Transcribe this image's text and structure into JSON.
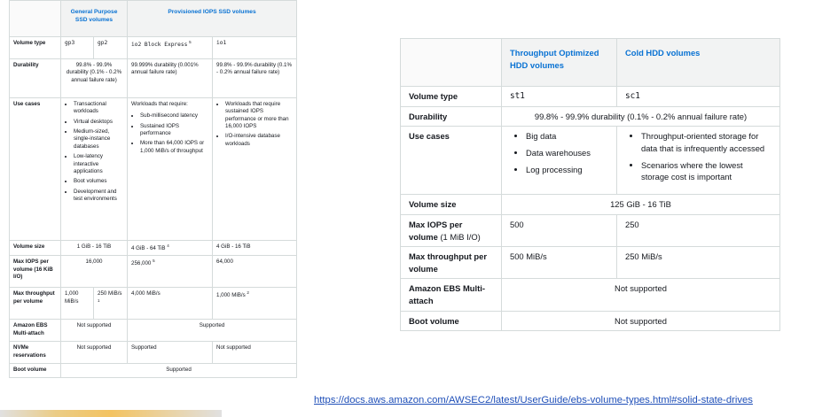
{
  "ssd_table": {
    "headers": {
      "general": "General Purpose SSD volumes",
      "provisioned": "Provisioned IOPS SSD volumes"
    },
    "volume_type": {
      "label": "Volume type",
      "gp3": "gp3",
      "gp2": "gp2",
      "io2": "io2 Block Express",
      "io2_sup": "5",
      "io1": "io1"
    },
    "durability": {
      "label": "Durability",
      "general": "99.8% - 99.9% durability (0.1% - 0.2% annual failure rate)",
      "io2": "99.999% durability (0.001% annual failure rate)",
      "io1": "99.8% - 99.9% durability (0.1% - 0.2% annual failure rate)"
    },
    "use_cases": {
      "label": "Use cases",
      "general": [
        "Transactional workloads",
        "Virtual desktops",
        "Medium-sized, single-instance databases",
        "Low-latency interactive applications",
        "Boot volumes",
        "Development and test environments"
      ],
      "io2_intro": "Workloads that require:",
      "io2": [
        "Sub-millisecond latency",
        "Sustained IOPS performance",
        "More than 64,000 IOPS or 1,000 MiB/s of throughput"
      ],
      "io1": [
        "Workloads that require sustained IOPS performance or more than 16,000 IOPS",
        "I/O-intensive database workloads"
      ]
    },
    "volume_size": {
      "label": "Volume size",
      "general": "1 GiB - 16 TiB",
      "io2": "4 GiB - 64 TiB",
      "io2_sup": "4",
      "io1": "4 GiB - 16 TiB"
    },
    "max_iops": {
      "label": "Max IOPS per volume (16 KiB I/O)",
      "general": "16,000",
      "io2": "256,000",
      "io2_sup": "5",
      "io1": "64,000"
    },
    "max_throughput": {
      "label": "Max throughput per volume",
      "gp3": "1,000 MiB/s",
      "gp2": "250 MiB/s",
      "gp2_sup": "1",
      "io2": "4,000 MiB/s",
      "io1": "1,000 MiB/s",
      "io1_sup": "2"
    },
    "multi_attach": {
      "label": "Amazon EBS Multi-attach",
      "general": "Not supported",
      "provisioned": "Supported"
    },
    "nvme": {
      "label": "NVMe reservations",
      "general": "Not supported",
      "io2": "Supported",
      "io1": "Not supported"
    },
    "boot": {
      "label": "Boot volume",
      "all": "Supported"
    }
  },
  "hdd_table": {
    "headers": {
      "throughput": "Throughput Optimized HDD volumes",
      "cold": "Cold HDD volumes"
    },
    "volume_type": {
      "label": "Volume type",
      "st1": "st1",
      "sc1": "sc1"
    },
    "durability": {
      "label": "Durability",
      "value": "99.8% - 99.9% durability (0.1% - 0.2% annual failure rate)"
    },
    "use_cases": {
      "label": "Use cases",
      "st1": [
        "Big data",
        "Data warehouses",
        "Log processing"
      ],
      "sc1": [
        "Throughput-oriented storage for data that is infrequently accessed",
        "Scenarios where the lowest storage cost is important"
      ]
    },
    "volume_size": {
      "label": "Volume size",
      "value": "125 GiB - 16 TiB"
    },
    "max_iops": {
      "label": "Max IOPS per volume",
      "label_suffix": "(1 MiB I/O)",
      "st1": "500",
      "sc1": "250"
    },
    "max_throughput": {
      "label": "Max throughput per volume",
      "st1": "500 MiB/s",
      "sc1": "250 MiB/s"
    },
    "multi_attach": {
      "label": "Amazon EBS Multi-attach",
      "value": "Not supported"
    },
    "boot": {
      "label": "Boot volume",
      "value": "Not supported"
    }
  },
  "link": {
    "text": "https://docs.aws.amazon.com/AWSEC2/latest/UserGuide/ebs-volume-types.html#solid-state-drives"
  }
}
